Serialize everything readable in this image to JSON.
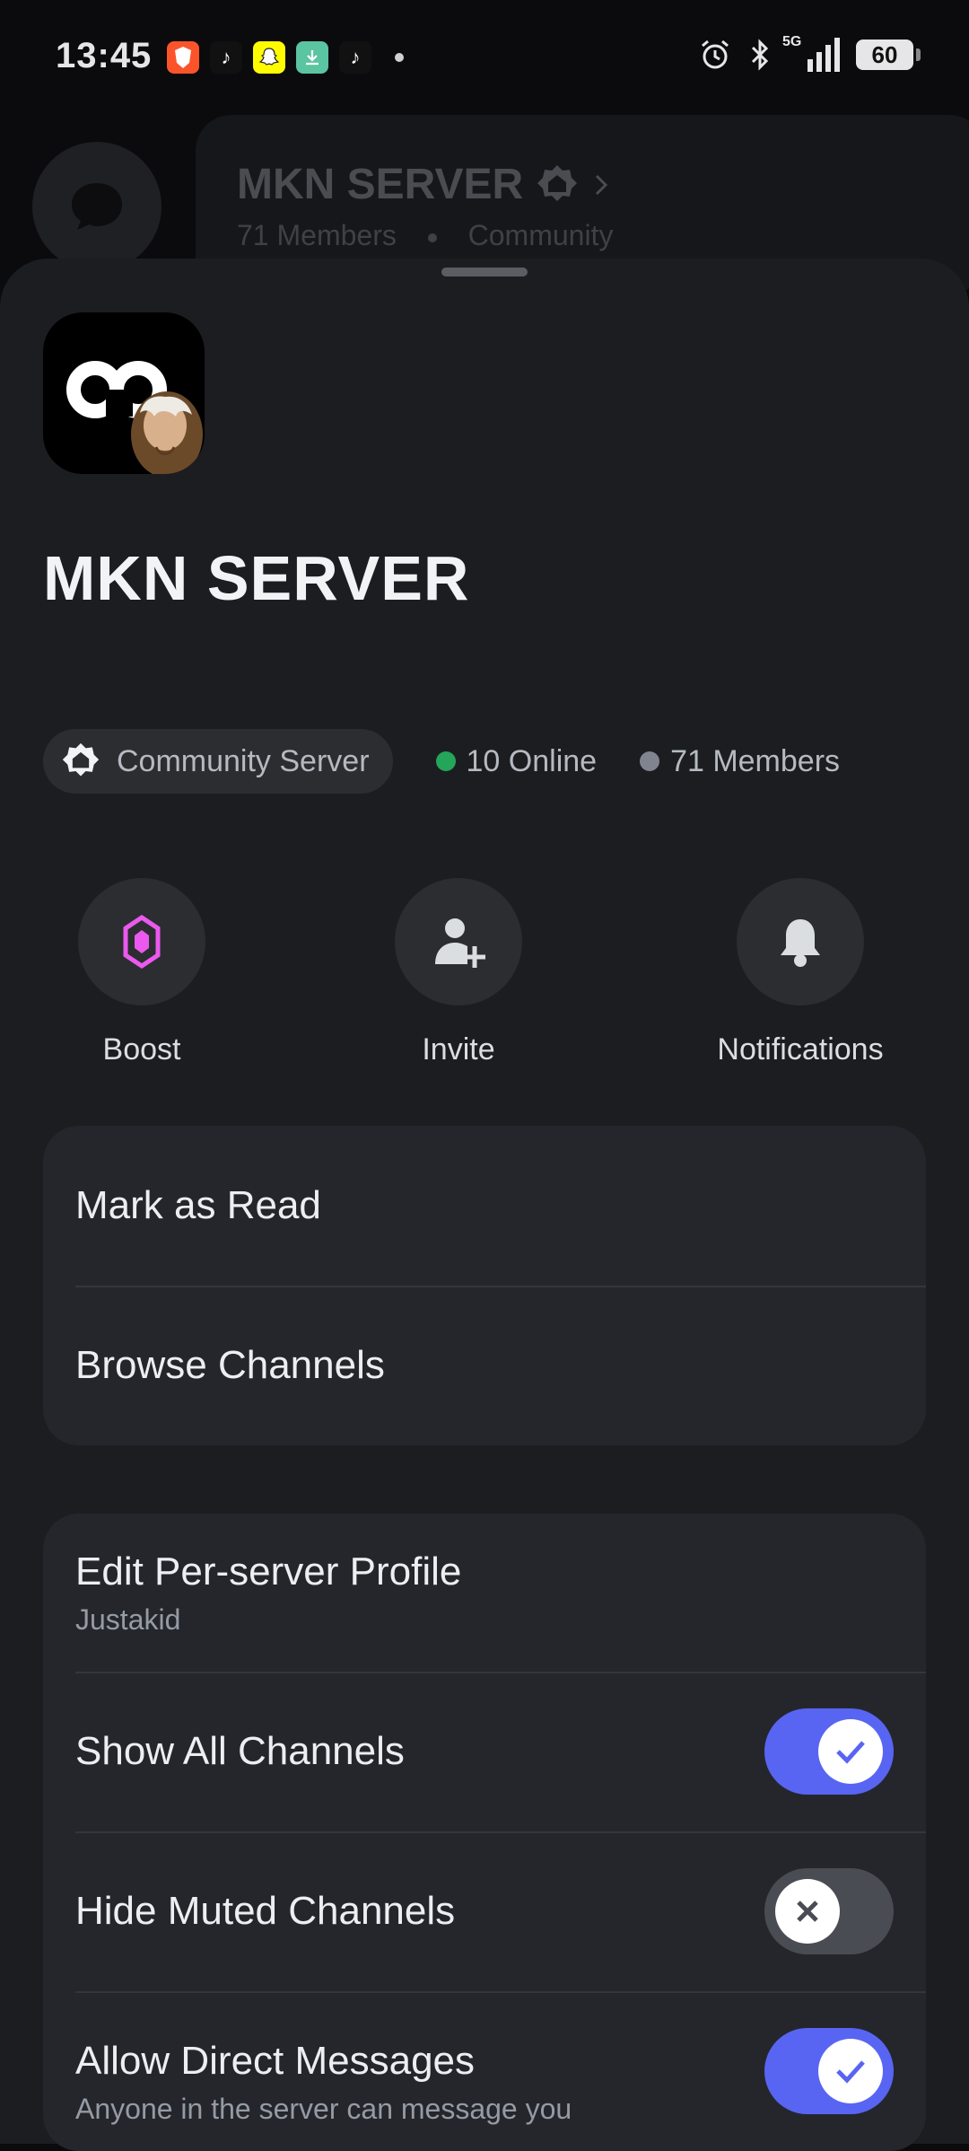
{
  "status_bar": {
    "time": "13:45",
    "network": "5G",
    "battery": "60"
  },
  "background_header": {
    "title": "MKN SERVER",
    "subtitle_members": "71 Members",
    "subtitle_type": "Community"
  },
  "sheet": {
    "server_name": "MKN SERVER",
    "community_label": "Community Server",
    "online": "10 Online",
    "members": "71 Members",
    "colors": {
      "online": "#23a55a",
      "members": "#80848e",
      "accent": "#5865f2",
      "boost": "#eb59ee"
    },
    "actions": [
      {
        "label": "Boost",
        "icon": "boost-gem-icon"
      },
      {
        "label": "Invite",
        "icon": "add-person-icon"
      },
      {
        "label": "Notifications",
        "icon": "bell-icon"
      }
    ],
    "group1": {
      "mark_read": "Mark as Read",
      "browse_channels": "Browse Channels"
    },
    "group2": {
      "edit_profile": "Edit Per-server Profile",
      "edit_profile_sub": "Justakid",
      "show_all_channels": "Show All Channels",
      "show_all_channels_on": true,
      "hide_muted_channels": "Hide Muted Channels",
      "hide_muted_channels_on": false,
      "allow_dm": "Allow Direct Messages",
      "allow_dm_sub": "Anyone in the server can message you",
      "allow_dm_on": true
    }
  }
}
